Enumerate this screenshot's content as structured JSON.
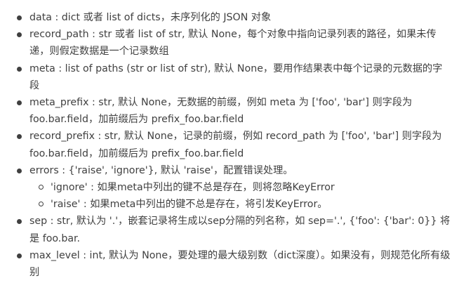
{
  "params": [
    {
      "text": "data : dict 或者 list of dicts，未序列化的 JSON 对象"
    },
    {
      "text": "record_path : str 或者 list of str, 默认 None，每个对象中指向记录列表的路径，如果未传递，则假定数据是一个记录数组"
    },
    {
      "text": "meta : list of paths (str or list of str), 默认 None，要用作结果表中每个记录的元数据的字段"
    },
    {
      "text": "meta_prefix : str, 默认 None，无数据的前缀，例如 meta 为 ['foo', 'bar'] 则字段为 foo.bar.field，加前缀后为 prefix_foo.bar.field"
    },
    {
      "text": "record_prefix : str, 默认 None，记录的前缀，例如 record_path 为 ['foo', 'bar'] 则字段为 foo.bar.field，加前缀后为 prefix_foo.bar.field"
    },
    {
      "text": "errors : {'raise', 'ignore'}, 默认 'raise'，配置错误处理。",
      "sub": [
        {
          "text": "'ignore' : 如果meta中列出的键不总是存在，则将忽略KeyError"
        },
        {
          "text": "'raise' : 如果meta中列出的键不总是存在，将引发KeyError。"
        }
      ]
    },
    {
      "text": "sep : str, 默认为 '.'，嵌套记录将生成以sep分隔的列名称，如 sep='.', {'foo': {'bar': 0}} 将是 foo.bar."
    },
    {
      "text": "max_level : int, 默认为 None，要处理的最大级别数（dict深度）。如果没有，则规范化所有级别"
    }
  ]
}
